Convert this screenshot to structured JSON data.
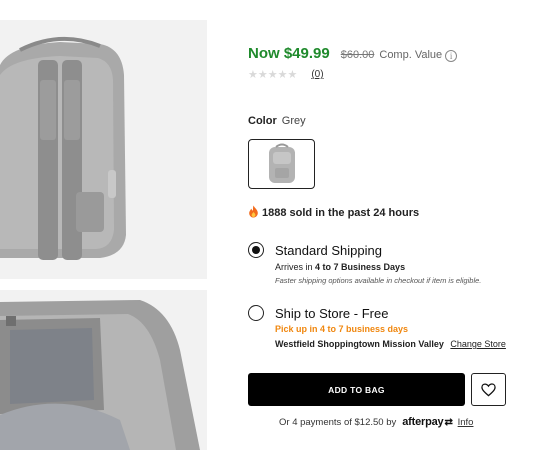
{
  "price": {
    "now": "Now $49.99",
    "was": "$60.00",
    "comp_label": "Comp. Value",
    "info_glyph": "i"
  },
  "rating": {
    "stars": "★★★★★",
    "count": "(0)"
  },
  "color": {
    "label": "Color",
    "value": "Grey"
  },
  "sold": {
    "text": "1888 sold in the past 24 hours",
    "icon": "fire-icon"
  },
  "shipping": {
    "standard": {
      "title": "Standard Shipping",
      "arrives_prefix": "Arrives in",
      "arrives_days": "4 to 7 Business Days",
      "note": "Faster shipping options available in checkout if item is eligible.",
      "selected": true
    },
    "store": {
      "title": "Ship to Store - Free",
      "pickup": "Pick up in 4 to 7 business days",
      "store_name": "Westfield Shoppingtown Mission Valley",
      "change_label": "Change Store",
      "selected": false
    }
  },
  "actions": {
    "add_to_bag": "ADD TO BAG",
    "favorite_icon": "heart-icon"
  },
  "afterpay": {
    "text": "Or 4 payments of $12.50 by",
    "brand": "afterpay",
    "info": "Info"
  },
  "colors": {
    "price_green": "#1f8a2c",
    "pickup_orange": "#f0870f",
    "button_black": "#000000"
  }
}
